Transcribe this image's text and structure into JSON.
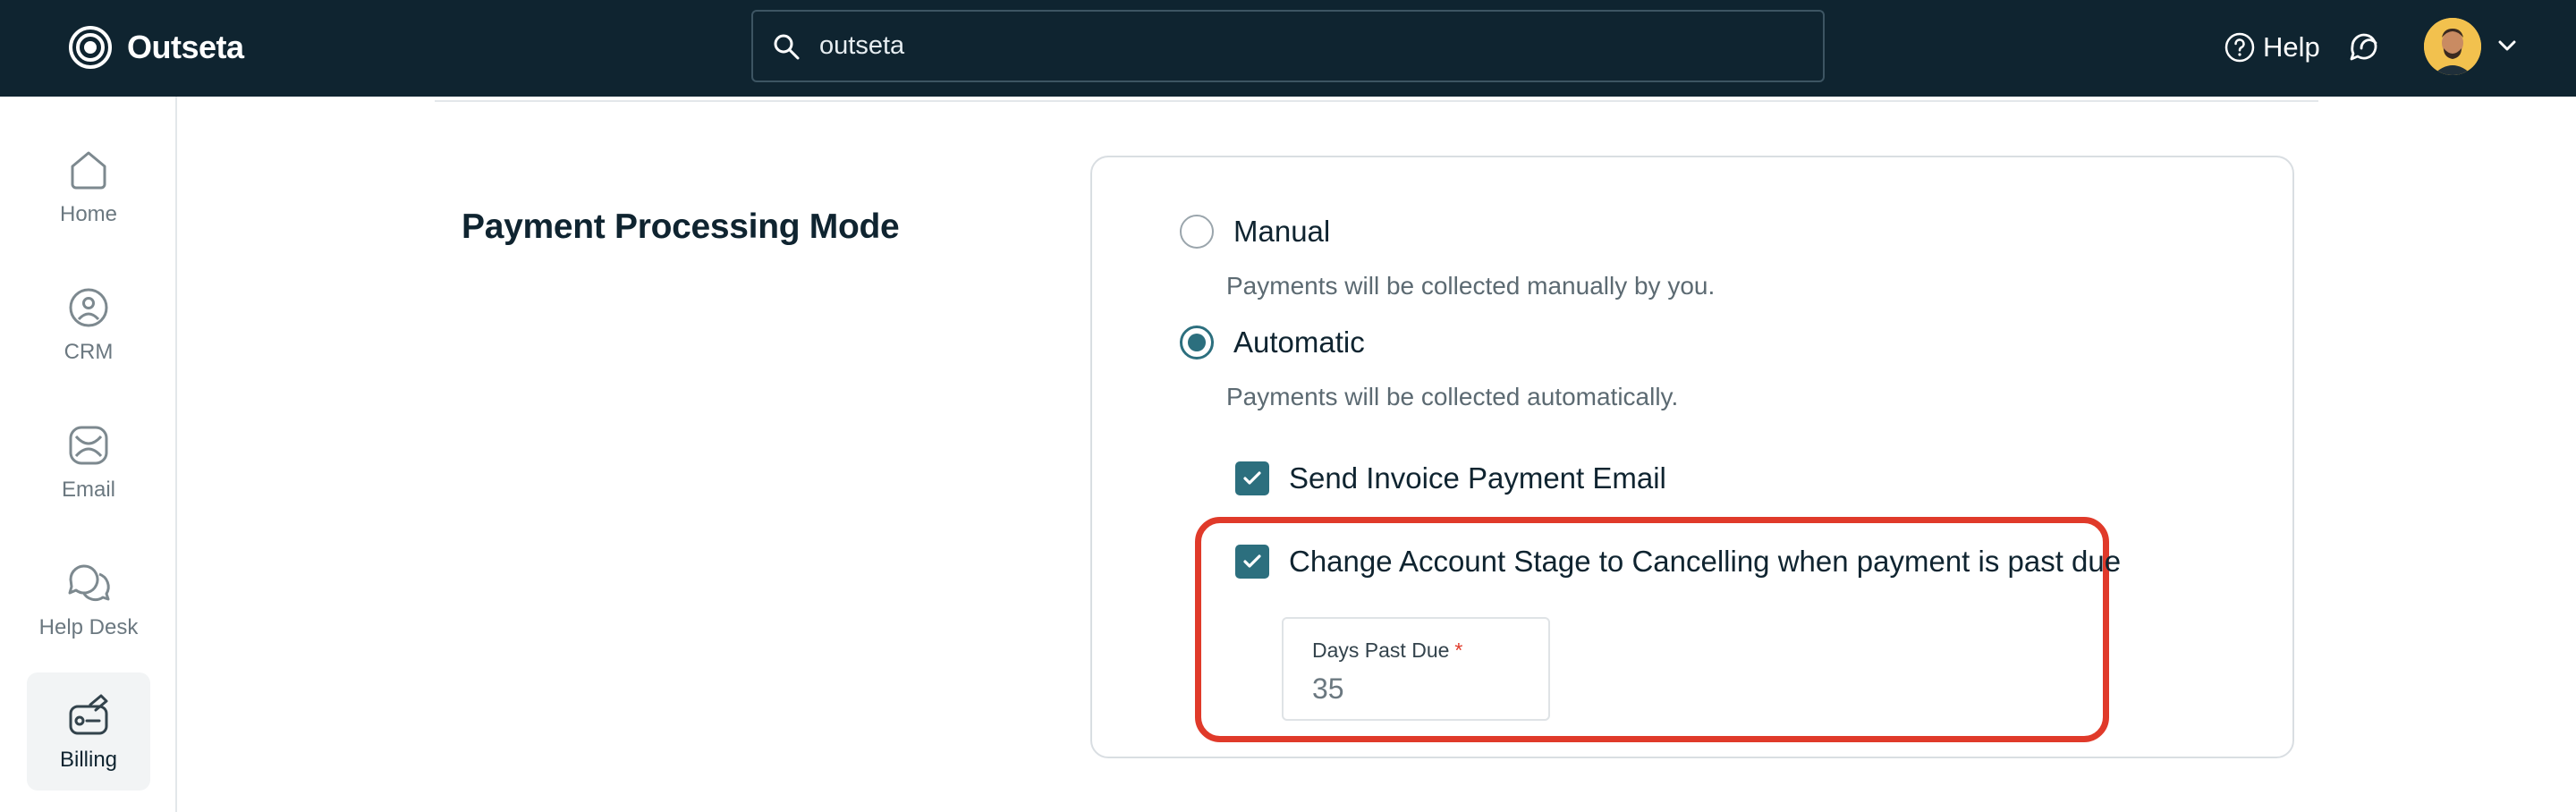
{
  "app": {
    "name": "Outseta",
    "brand_color": "#0f2430",
    "accent_color": "#2c6f7e",
    "highlight_color": "#e03a2a"
  },
  "header": {
    "search_value": "outseta",
    "help_label": "Help",
    "icons": [
      "search-icon",
      "help-icon",
      "chat-icon",
      "avatar",
      "chevron-down-icon"
    ]
  },
  "sidebar": {
    "items": [
      {
        "label": "Home",
        "icon": "home-icon",
        "active": false
      },
      {
        "label": "CRM",
        "icon": "crm-icon",
        "active": false
      },
      {
        "label": "Email",
        "icon": "email-icon",
        "active": false
      },
      {
        "label": "Help Desk",
        "icon": "help-desk-icon",
        "active": false
      },
      {
        "label": "Billing",
        "icon": "billing-icon",
        "active": true
      }
    ]
  },
  "main": {
    "section_title": "Payment Processing Mode",
    "options": [
      {
        "label": "Manual",
        "description": "Payments will be collected manually by you.",
        "selected": false
      },
      {
        "label": "Automatic",
        "description": "Payments will be collected automatically.",
        "selected": true
      }
    ],
    "checkboxes": [
      {
        "label": "Send Invoice Payment Email",
        "checked": true
      },
      {
        "label": "Change Account Stage to Cancelling when payment is past due",
        "checked": true
      }
    ],
    "days_past_due": {
      "label": "Days Past Due",
      "required_marker": "*",
      "value": "35"
    }
  }
}
